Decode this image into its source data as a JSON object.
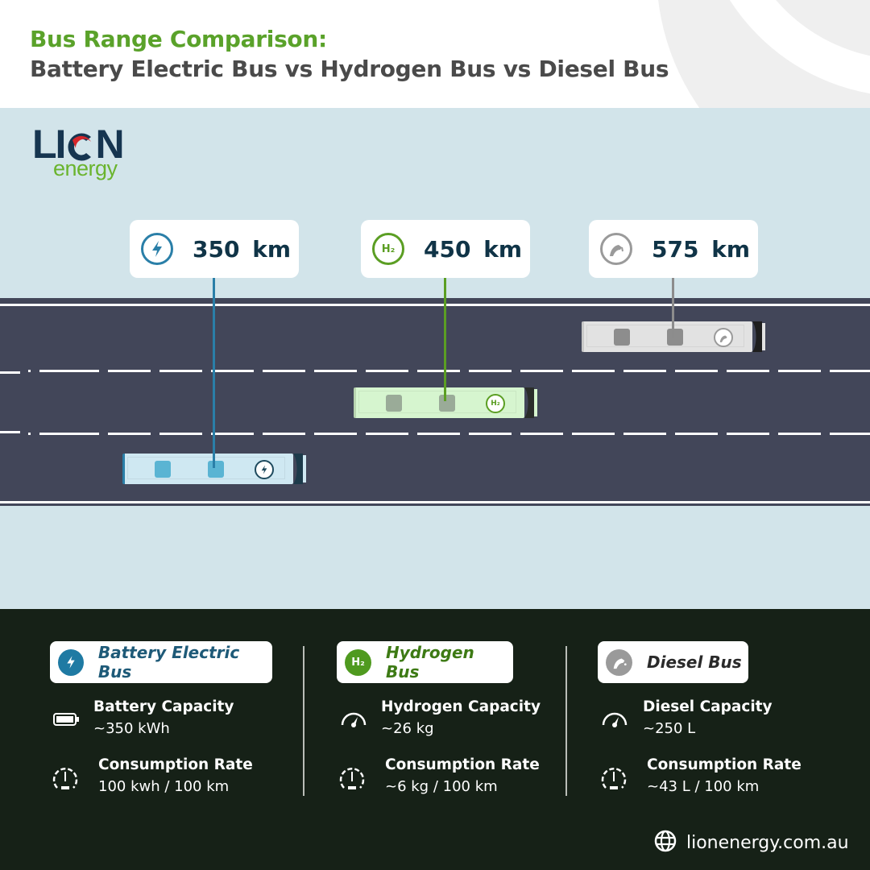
{
  "header": {
    "title_line1": "Bus Range Comparison:",
    "title_line2": "Battery Electric Bus vs Hydrogen Bus vs Diesel Bus"
  },
  "logo": {
    "wordmark": "LION",
    "sub": "energy"
  },
  "colors": {
    "green": "#5aa22a",
    "electric": "#2a7fa8",
    "hydrogen": "#5b9e23",
    "diesel": "#9a9a9a",
    "road": "#424659",
    "sky": "#d2e4ea",
    "panel": "#162117"
  },
  "buses": [
    {
      "id": "electric",
      "icon": "lightning-icon",
      "range_value": "350",
      "range_unit": "km",
      "range_km": 350,
      "badge": "⚡",
      "tag_label": "Battery Electric Bus",
      "capacity_label": "Battery Capacity",
      "capacity_value": "~350 kWh",
      "capacity_icon": "battery-icon",
      "rate_label": "Consumption Rate",
      "rate_value": "100 kwh / 100 km",
      "rate_icon": "speedometer-icon"
    },
    {
      "id": "hydrogen",
      "icon": "h2-icon",
      "range_value": "450",
      "range_unit": "km",
      "range_km": 450,
      "badge": "H₂",
      "tag_label": "Hydrogen Bus",
      "capacity_label": "Hydrogen Capacity",
      "capacity_value": "~26 kg",
      "capacity_icon": "gauge-icon",
      "rate_label": "Consumption Rate",
      "rate_value": "~6 kg / 100 km",
      "rate_icon": "speedometer-icon"
    },
    {
      "id": "diesel",
      "icon": "fuel-nozzle-icon",
      "range_value": "575",
      "range_unit": "km",
      "range_km": 575,
      "badge": "",
      "tag_label": "Diesel Bus",
      "capacity_label": "Diesel Capacity",
      "capacity_value": "~250 L",
      "capacity_icon": "gauge-icon",
      "rate_label": "Consumption Rate",
      "rate_value": "~43 L / 100 km",
      "rate_icon": "speedometer-icon"
    }
  ],
  "footer": {
    "website": "lionenergy.com.au",
    "icon": "globe-icon"
  }
}
